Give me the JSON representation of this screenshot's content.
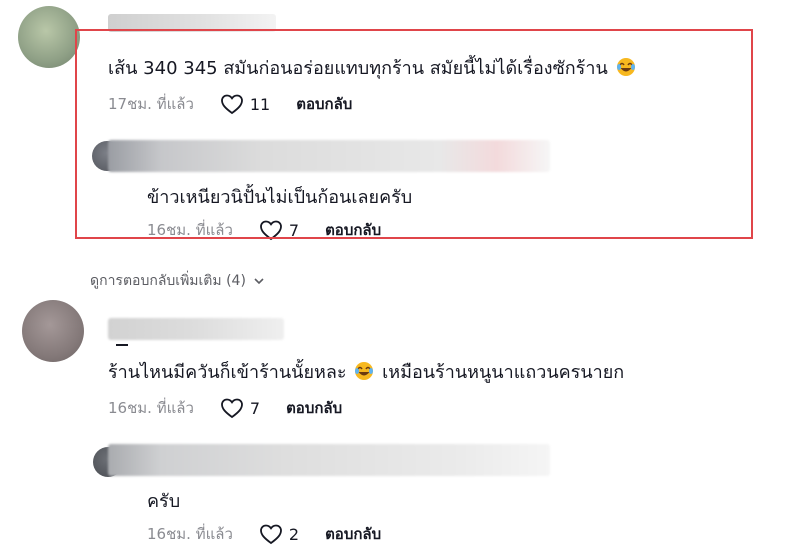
{
  "comments": [
    {
      "text": "เส้น 340 345 สมันก่อนอร่อยแทบทุกร้าน สมัยนี้ไม่ได้เรื่องซักร้าน",
      "emoji": "laughing-tears",
      "time": "17ชม. ที่แล้ว",
      "likes": "11",
      "reply_label": "ตอบกลับ"
    },
    {
      "text": "ข้าวเหนียวนิปั้นไม่เป็นก้อนเลยครับ",
      "time": "16ชม. ที่แล้ว",
      "likes": "7",
      "reply_label": "ตอบกลับ"
    },
    {
      "text_before_emoji": "ร้านไหนมีควันก็เข้าร้านนั้ยหละ",
      "emoji": "laughing-tears",
      "text_after_emoji": "เหมือนร้านหนูนาแถวนครนายก",
      "time": "16ชม. ที่แล้ว",
      "likes": "7",
      "reply_label": "ตอบกลับ"
    },
    {
      "text": "ครับ",
      "time": "16ชม. ที่แล้ว",
      "likes": "2",
      "reply_label": "ตอบกลับ"
    }
  ],
  "more_replies": "ดูการตอบกลับเพิ่มเติม (4)",
  "colors": {
    "highlight_border": "#e0454a",
    "text": "#161823",
    "muted": "#8a8b91"
  }
}
